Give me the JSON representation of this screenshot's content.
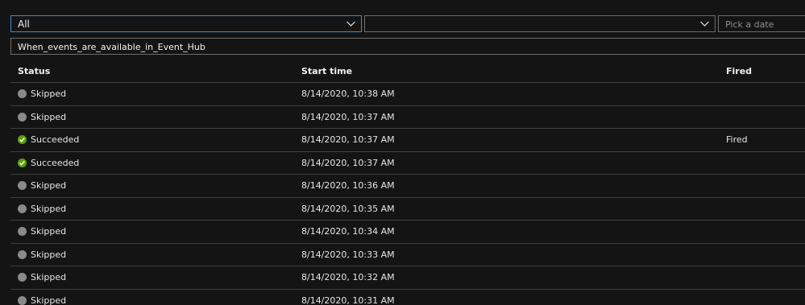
{
  "filters": {
    "status_select": {
      "value": "All"
    },
    "second_select": {
      "value": ""
    },
    "date_picker": {
      "placeholder": "Pick a date"
    },
    "trigger_name": "When_events_are_available_in_Event_Hub"
  },
  "table": {
    "columns": [
      "Status",
      "Start time",
      "Fired"
    ],
    "rows": [
      {
        "status": "Skipped",
        "start_time": "8/14/2020, 10:38 AM",
        "fired": ""
      },
      {
        "status": "Skipped",
        "start_time": "8/14/2020, 10:37 AM",
        "fired": ""
      },
      {
        "status": "Succeeded",
        "start_time": "8/14/2020, 10:37 AM",
        "fired": "Fired"
      },
      {
        "status": "Succeeded",
        "start_time": "8/14/2020, 10:37 AM",
        "fired": ""
      },
      {
        "status": "Skipped",
        "start_time": "8/14/2020, 10:36 AM",
        "fired": ""
      },
      {
        "status": "Skipped",
        "start_time": "8/14/2020, 10:35 AM",
        "fired": ""
      },
      {
        "status": "Skipped",
        "start_time": "8/14/2020, 10:34 AM",
        "fired": ""
      },
      {
        "status": "Skipped",
        "start_time": "8/14/2020, 10:33 AM",
        "fired": ""
      },
      {
        "status": "Skipped",
        "start_time": "8/14/2020, 10:32 AM",
        "fired": ""
      },
      {
        "status": "Skipped",
        "start_time": "8/14/2020, 10:31 AM",
        "fired": ""
      }
    ]
  },
  "colors": {
    "background": "#141414",
    "focus_border": "#3a8fd6",
    "succeeded": "#57a300",
    "skipped": "#8a8a8a"
  }
}
